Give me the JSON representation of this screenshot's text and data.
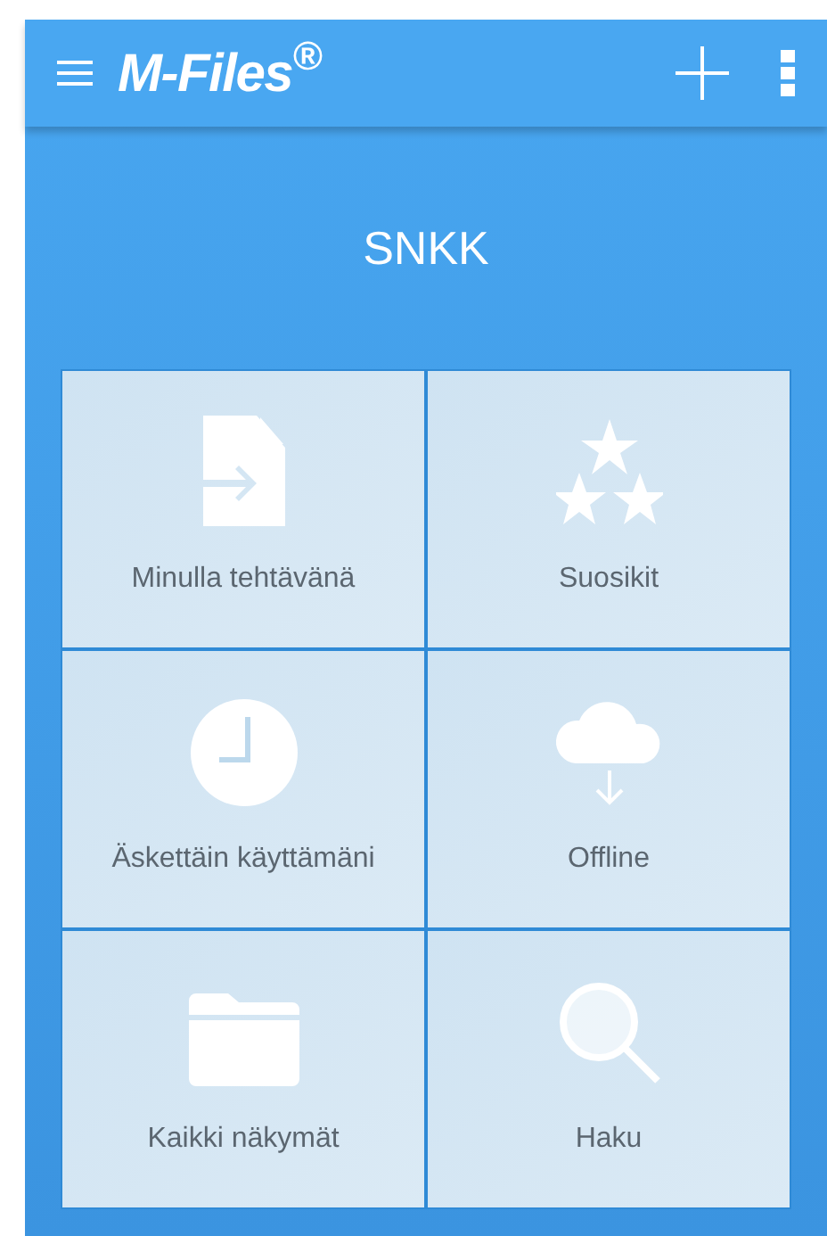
{
  "app_bar": {
    "logo": "M-Files$^{®}$"
  },
  "vault": {
    "title": "SNKK"
  },
  "tiles": [
    {
      "kind": "tasks",
      "label": "Minulla tehtävänä"
    },
    {
      "kind": "favorites",
      "label": "Suosikit"
    },
    {
      "kind": "recent",
      "label": "Äskettäin käyttämäni"
    },
    {
      "kind": "offline",
      "label": "Offline"
    },
    {
      "kind": "views",
      "label": "Kaikki näkymät"
    },
    {
      "kind": "search",
      "label": "Haku"
    }
  ]
}
